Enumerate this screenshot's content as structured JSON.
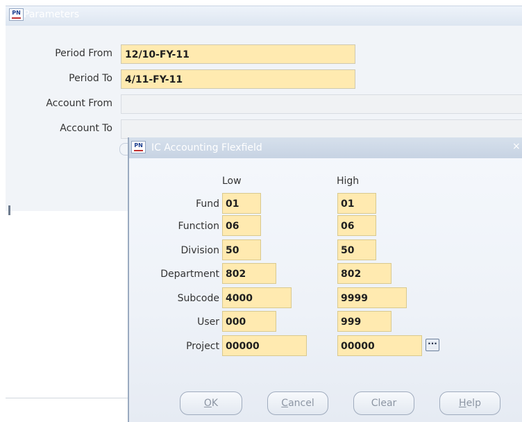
{
  "parameters_window": {
    "title": "Parameters",
    "icon_label": "PN",
    "fields": [
      {
        "label": "Period From",
        "value": "12/10-FY-11"
      },
      {
        "label": "Period To",
        "value": "4/11-FY-11"
      },
      {
        "label": "Account From",
        "value": ""
      },
      {
        "label": "Account To",
        "value": ""
      }
    ]
  },
  "flexfield_dialog": {
    "title": "IC Accounting Flexfield",
    "icon_label": "PN",
    "close_glyph": "×",
    "columns": {
      "low": "Low",
      "high": "High"
    },
    "rows": [
      {
        "label": "Fund",
        "low": "01",
        "high": "01"
      },
      {
        "label": "Function",
        "low": "06",
        "high": "06"
      },
      {
        "label": "Division",
        "low": "50",
        "high": "50"
      },
      {
        "label": "Department",
        "low": "802",
        "high": "802"
      },
      {
        "label": "Subcode",
        "low": "4000",
        "high": "9999"
      },
      {
        "label": "User",
        "low": "000",
        "high": "999"
      },
      {
        "label": "Project",
        "low": "00000",
        "high": "00000"
      }
    ],
    "lov_glyph": "···",
    "buttons": {
      "ok": {
        "mnemonic": "O",
        "rest": "K"
      },
      "cancel": {
        "mnemonic": "C",
        "rest": "ancel"
      },
      "clear": {
        "label": "Clear"
      },
      "help": {
        "mnemonic": "H",
        "rest": "elp"
      }
    }
  },
  "colors": {
    "field_fill": "#ffeab0",
    "titlebar_text": "#ffffff",
    "window_bg": "#f1f4f8"
  }
}
